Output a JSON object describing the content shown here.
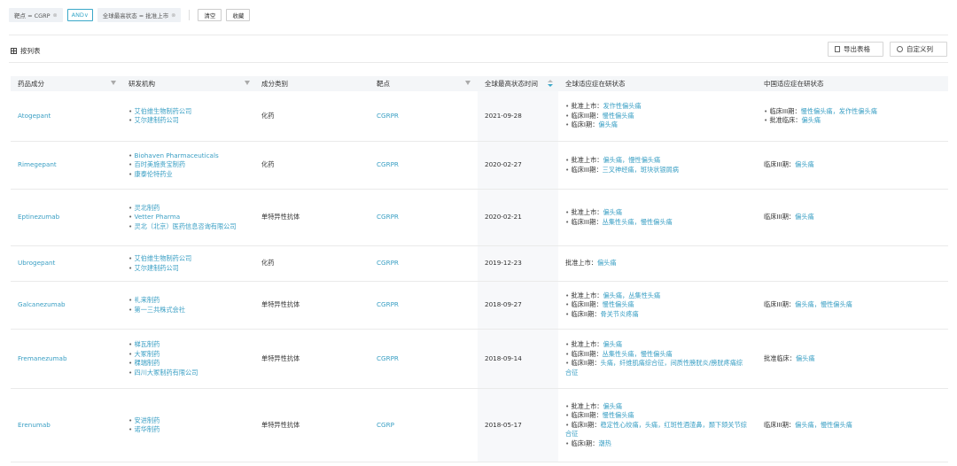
{
  "filters": {
    "chips": [
      {
        "label": "靶点 = CGRP"
      },
      {
        "label": "全球最高状态 = 批准上市"
      }
    ],
    "and_label": "AND∨",
    "clear_label": "清空",
    "save_label": "收藏"
  },
  "view": {
    "title": "按列表",
    "export_label": "导出表格",
    "custom_cols_label": "自定义列"
  },
  "table": {
    "headers": [
      "药品成分",
      "研发机构",
      "成分类别",
      "靶点",
      "全球最高状态时间",
      "全球适应症在研状态",
      "中国适应症在研状态"
    ],
    "rows": [
      {
        "drug": "Atogepant",
        "orgs": [
          "艾伯维生物制药公司",
          "艾尔建制药公司"
        ],
        "category": "化药",
        "target": "CGRPR",
        "date": "2021-09-28",
        "global": [
          {
            "stage": "批准上市：",
            "ind": "发作性偏头痛"
          },
          {
            "stage": "临床III期：",
            "ind": "慢性偏头痛"
          },
          {
            "stage": "临床I期：",
            "ind": "偏头痛"
          }
        ],
        "china": [
          {
            "stage": "临床III期：",
            "ind": "慢性偏头痛，发作性偏头痛"
          },
          {
            "stage": "批准临床：",
            "ind": "偏头痛"
          }
        ]
      },
      {
        "drug": "Rimegepant",
        "orgs": [
          "Biohaven Pharmaceuticals",
          "百时美施贵宝制药",
          "康泰伦特药业"
        ],
        "category": "化药",
        "target": "CGRPR",
        "date": "2020-02-27",
        "global": [
          {
            "stage": "批准上市：",
            "ind": "偏头痛，慢性偏头痛"
          },
          {
            "stage": "临床III期：",
            "ind": "三叉神经痛，斑块状银屑病"
          }
        ],
        "china": [
          {
            "stage": "临床III期：",
            "ind": "偏头痛"
          }
        ]
      },
      {
        "drug": "Eptinezumab",
        "orgs": [
          "灵北制药",
          "Vetter Pharma",
          "灵北（北京）医药信息咨询有限公司"
        ],
        "category": "单特异性抗体",
        "target": "CGRPR",
        "date": "2020-02-21",
        "global": [
          {
            "stage": "批准上市：",
            "ind": "偏头痛"
          },
          {
            "stage": "临床III期：",
            "ind": "丛集性头痛，慢性偏头痛"
          }
        ],
        "china": [
          {
            "stage": "临床III期：",
            "ind": "偏头痛"
          }
        ]
      },
      {
        "drug": "Ubrogepant",
        "orgs": [
          "艾伯维生物制药公司",
          "艾尔建制药公司"
        ],
        "category": "化药",
        "target": "CGRPR",
        "date": "2019-12-23",
        "global": [
          {
            "stage": "批准上市：",
            "ind": "偏头痛"
          }
        ],
        "china": []
      },
      {
        "drug": "Galcanezumab",
        "orgs": [
          "礼来制药",
          "第一三共株式会社"
        ],
        "category": "单特异性抗体",
        "target": "CGRPR",
        "date": "2018-09-27",
        "global": [
          {
            "stage": "批准上市：",
            "ind": "偏头痛，丛集性头痛"
          },
          {
            "stage": "临床III期：",
            "ind": "慢性偏头痛"
          },
          {
            "stage": "临床II期：",
            "ind": "骨关节炎疼痛"
          }
        ],
        "china": [
          {
            "stage": "临床III期：",
            "ind": "偏头痛，慢性偏头痛"
          }
        ]
      },
      {
        "drug": "Fremanezumab",
        "orgs": [
          "梯瓦制药",
          "大冢制药",
          "稞瑞制药",
          "四川大冢制药有限公司"
        ],
        "category": "单特异性抗体",
        "target": "CGRPR",
        "date": "2018-09-14",
        "global": [
          {
            "stage": "批准上市：",
            "ind": "偏头痛"
          },
          {
            "stage": "临床III期：",
            "ind": "丛集性头痛，慢性偏头痛"
          },
          {
            "stage": "临床II期：",
            "ind": "头痛，纤维肌痛综合征，间质性膀胱炎/膀胱疼痛综合征"
          }
        ],
        "china": [
          {
            "stage": "批准临床：",
            "ind": "偏头痛"
          }
        ]
      },
      {
        "drug": "Erenumab",
        "orgs": [
          "安进制药",
          "诺华制药"
        ],
        "category": "单特异性抗体",
        "target": "CGRP",
        "date": "2018-05-17",
        "global": [
          {
            "stage": "批准上市：",
            "ind": "偏头痛"
          },
          {
            "stage": "临床III期：",
            "ind": "慢性偏头痛"
          },
          {
            "stage": "临床II期：",
            "ind": "稳定性心绞痛，头痛，红斑性酒渣鼻，颞下颌关节综合征"
          },
          {
            "stage": "临床I期：",
            "ind": "潮热"
          }
        ],
        "china": [
          {
            "stage": "临床III期：",
            "ind": "偏头痛，慢性偏头痛"
          }
        ]
      }
    ],
    "single_line_china_row3": "批准上市：偏头痛"
  },
  "colors": {
    "accent": "#3a9fc4",
    "header_bg": "#f4f6f8"
  }
}
